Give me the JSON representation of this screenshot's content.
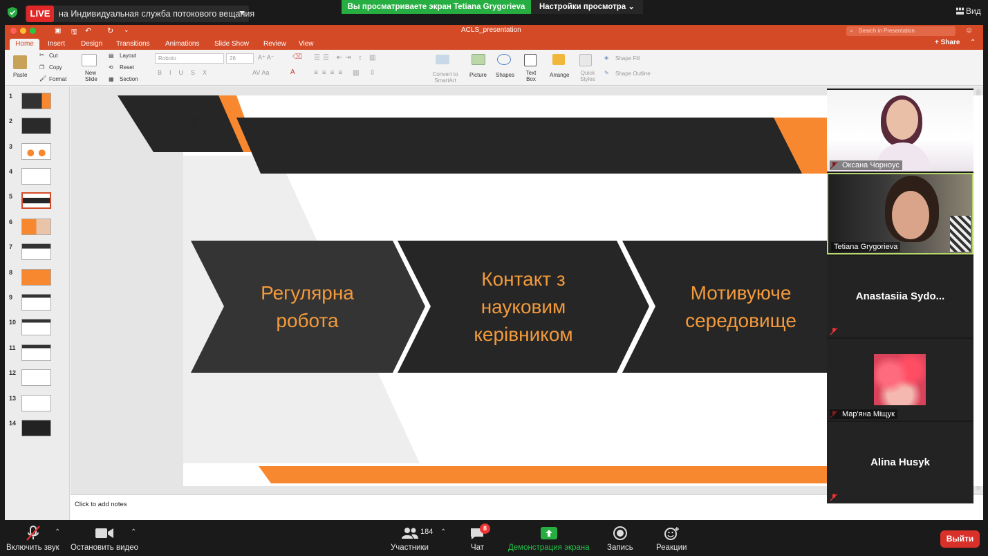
{
  "zoom": {
    "live_label": "LIVE",
    "stream_text": "на Индивидуальная служба потокового вещания",
    "viewing_banner": "Вы просматриваете экран Tetiana Grygorieva",
    "view_settings": "Настройки просмотра",
    "view_button": "Вид",
    "bottom": {
      "unmute": "Включить звук",
      "stop_video": "Остановить видео",
      "participants": "Участники",
      "participants_count": "184",
      "chat": "Чат",
      "chat_badge": "8",
      "share_screen": "Демонстрация экрана",
      "record": "Запись",
      "reactions": "Реакции",
      "leave": "Выйти"
    },
    "accent_green": "#27ae42",
    "accent_red": "#e02828"
  },
  "ppt": {
    "title": "ACLS_presentation",
    "search_placeholder": "Search in Presentation",
    "share": "Share",
    "tabs": [
      "Home",
      "Insert",
      "Design",
      "Transitions",
      "Animations",
      "Slide Show",
      "Review",
      "View"
    ],
    "ribbon": {
      "paste": "Paste",
      "cut": "Cut",
      "copy": "Copy",
      "format": "Format",
      "new_slide": "New Slide",
      "layout": "Layout",
      "reset": "Reset",
      "section": "Section",
      "font_name": "Roboto",
      "font_size": "26",
      "convert_smartart": "Convert to SmartArt",
      "picture": "Picture",
      "shapes": "Shapes",
      "text_box": "Text Box",
      "arrange": "Arrange",
      "quick_styles": "Quick Styles",
      "shape_fill": "Shape Fill",
      "shape_outline": "Shape Outline"
    },
    "slide_numbers": [
      "1",
      "2",
      "3",
      "4",
      "5",
      "6",
      "7",
      "8",
      "9",
      "10",
      "11",
      "12",
      "13",
      "14"
    ],
    "selected_slide": 5,
    "notes_placeholder": "Click to add notes",
    "brand_orange": "#f7882f",
    "brand_dark": "#262626"
  },
  "slide": {
    "number": "5",
    "chevron1": [
      "Регулярна",
      "робота"
    ],
    "chevron2": [
      "Контакт з",
      "науковим",
      "керівником"
    ],
    "chevron3": [
      "Мотивуюче",
      "середовище"
    ]
  },
  "participants": [
    {
      "name": "Оксана Чорноус",
      "muted": true
    },
    {
      "name": "Tetiana Grygorieva",
      "muted": false
    },
    {
      "name": "Anastasiia  Sydo...",
      "muted": true
    },
    {
      "name": "Мар'яна Міщук",
      "muted": true
    },
    {
      "name": "Alina Husyk",
      "muted": true
    }
  ]
}
